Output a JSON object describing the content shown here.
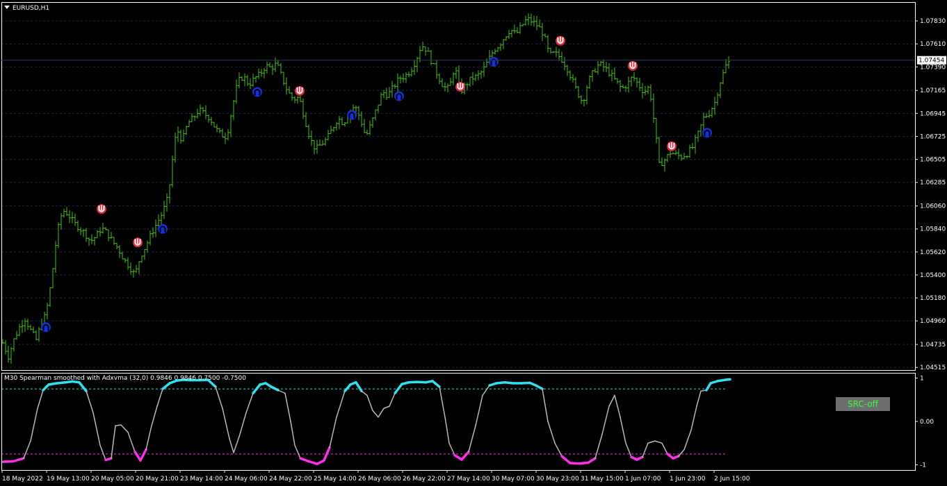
{
  "symbol_label": "EURUSD,H1",
  "indicator_title": "M30 Spearman smoothed with Adxvma (32,0) 0.9846 0.9846 0.7500 -0.7500",
  "button_label": "SRC-off",
  "current_price": "1.07454",
  "colors": {
    "background": "#000000",
    "bar": "#4cc11e",
    "axis": "#ffffff",
    "grid": "#1c2a52",
    "arrow_up": "#1531d8",
    "arrow_down": "#e2283c",
    "osc_line": "#b9b9b9",
    "osc_high": "#2ee0f0",
    "osc_low": "#ff2ee8",
    "level_high": "#2ee0f0",
    "level_low": "#ff2ee8"
  },
  "chart_data": [
    {
      "type": "ohlc",
      "name": "EURUSD,H1",
      "y_ticks": [
        "1.07830",
        "1.07610",
        "1.07390",
        "1.07165",
        "1.06945",
        "1.06725",
        "1.06505",
        "1.06285",
        "1.06060",
        "1.05840",
        "1.05620",
        "1.05400",
        "1.05180",
        "1.04960",
        "1.04735",
        "1.04515"
      ],
      "ylim": [
        1.0449,
        1.0801
      ],
      "current_price": 1.07454,
      "x_labels": [
        "18 May 2022",
        "19 May 13:00",
        "20 May 05:00",
        "20 May 21:00",
        "23 May 14:00",
        "24 May 06:00",
        "24 May 22:00",
        "25 May 14:00",
        "26 May 06:00",
        "26 May 22:00",
        "27 May 14:00",
        "30 May 07:00",
        "30 May 23:00",
        "31 May 15:00",
        "1 Jun 07:00",
        "1 Jun 23:00",
        "2 Jun 15:00"
      ],
      "close_path": [
        [
          0,
          1.0475
        ],
        [
          8,
          1.0462
        ],
        [
          16,
          1.0478
        ],
        [
          24,
          1.049
        ],
        [
          32,
          1.0498
        ],
        [
          40,
          1.0487
        ],
        [
          48,
          1.0478
        ],
        [
          56,
          1.0495
        ],
        [
          62,
          1.0502
        ],
        [
          70,
          1.0535
        ],
        [
          78,
          1.058
        ],
        [
          86,
          1.0602
        ],
        [
          94,
          1.0598
        ],
        [
          102,
          1.059
        ],
        [
          110,
          1.0585
        ],
        [
          118,
          1.058
        ],
        [
          126,
          1.0572
        ],
        [
          134,
          1.0577
        ],
        [
          142,
          1.0585
        ],
        [
          150,
          1.058
        ],
        [
          158,
          1.0572
        ],
        [
          166,
          1.0565
        ],
        [
          174,
          1.0555
        ],
        [
          182,
          1.0548
        ],
        [
          190,
          1.054
        ],
        [
          198,
          1.0558
        ],
        [
          206,
          1.0568
        ],
        [
          214,
          1.058
        ],
        [
          222,
          1.059
        ],
        [
          230,
          1.06
        ],
        [
          238,
          1.0615
        ],
        [
          244,
          1.065
        ],
        [
          250,
          1.068
        ],
        [
          258,
          1.0668
        ],
        [
          266,
          1.0685
        ],
        [
          274,
          1.069
        ],
        [
          282,
          1.0698
        ],
        [
          290,
          1.0694
        ],
        [
          298,
          1.069
        ],
        [
          306,
          1.068
        ],
        [
          314,
          1.0674
        ],
        [
          322,
          1.0672
        ],
        [
          330,
          1.07
        ],
        [
          338,
          1.0725
        ],
        [
          346,
          1.073
        ],
        [
          354,
          1.0722
        ],
        [
          362,
          1.0728
        ],
        [
          370,
          1.0732
        ],
        [
          378,
          1.074
        ],
        [
          386,
          1.0738
        ],
        [
          394,
          1.0742
        ],
        [
          402,
          1.0728
        ],
        [
          410,
          1.0715
        ],
        [
          418,
          1.0708
        ],
        [
          426,
          1.071
        ],
        [
          434,
          1.069
        ],
        [
          442,
          1.067
        ],
        [
          450,
          1.066
        ],
        [
          458,
          1.0665
        ],
        [
          466,
          1.067
        ],
        [
          474,
          1.068
        ],
        [
          482,
          1.069
        ],
        [
          490,
          1.0685
        ],
        [
          498,
          1.0695
        ],
        [
          506,
          1.0702
        ],
        [
          514,
          1.069
        ],
        [
          522,
          1.0672
        ],
        [
          530,
          1.0685
        ],
        [
          538,
          1.07
        ],
        [
          546,
          1.0715
        ],
        [
          554,
          1.0712
        ],
        [
          562,
          1.072
        ],
        [
          570,
          1.0728
        ],
        [
          578,
          1.073
        ],
        [
          586,
          1.0735
        ],
        [
          594,
          1.0745
        ],
        [
          602,
          1.076
        ],
        [
          610,
          1.0755
        ],
        [
          618,
          1.0742
        ],
        [
          626,
          1.073
        ],
        [
          634,
          1.072
        ],
        [
          642,
          1.0718
        ],
        [
          650,
          1.074
        ],
        [
          658,
          1.0715
        ],
        [
          666,
          1.0722
        ],
        [
          674,
          1.0728
        ],
        [
          682,
          1.073
        ],
        [
          690,
          1.0735
        ],
        [
          698,
          1.0745
        ],
        [
          706,
          1.0755
        ],
        [
          714,
          1.076
        ],
        [
          722,
          1.0768
        ],
        [
          730,
          1.0775
        ],
        [
          738,
          1.077
        ],
        [
          746,
          1.0778
        ],
        [
          754,
          1.0785
        ],
        [
          762,
          1.0782
        ],
        [
          770,
          1.0778
        ],
        [
          778,
          1.077
        ],
        [
          786,
          1.075
        ],
        [
          794,
          1.0752
        ],
        [
          802,
          1.0748
        ],
        [
          810,
          1.074
        ],
        [
          818,
          1.0728
        ],
        [
          826,
          1.0715
        ],
        [
          834,
          1.0705
        ],
        [
          842,
          1.0725
        ],
        [
          850,
          1.0735
        ],
        [
          858,
          1.0742
        ],
        [
          866,
          1.0738
        ],
        [
          874,
          1.0732
        ],
        [
          882,
          1.0725
        ],
        [
          890,
          1.0718
        ],
        [
          898,
          1.0722
        ],
        [
          906,
          1.073
        ],
        [
          914,
          1.0722
        ],
        [
          922,
          1.0715
        ],
        [
          930,
          1.072
        ],
        [
          938,
          1.068
        ],
        [
          944,
          1.0645
        ],
        [
          952,
          1.065
        ],
        [
          960,
          1.0657
        ],
        [
          968,
          1.0655
        ],
        [
          976,
          1.0653
        ],
        [
          984,
          1.0656
        ],
        [
          992,
          1.0662
        ],
        [
          1000,
          1.0675
        ],
        [
          1008,
          1.069
        ],
        [
          1016,
          1.0695
        ],
        [
          1024,
          1.0705
        ],
        [
          1032,
          1.0725
        ],
        [
          1040,
          1.074
        ],
        [
          1046,
          1.0745
        ]
      ],
      "signals": [
        {
          "x": 62,
          "price": 1.049,
          "dir": "up"
        },
        {
          "x": 142,
          "price": 1.0603,
          "dir": "down"
        },
        {
          "x": 194,
          "price": 1.0571,
          "dir": "down"
        },
        {
          "x": 230,
          "price": 1.0584,
          "dir": "up"
        },
        {
          "x": 366,
          "price": 1.0715,
          "dir": "up"
        },
        {
          "x": 427,
          "price": 1.0716,
          "dir": "down"
        },
        {
          "x": 502,
          "price": 1.0693,
          "dir": "up"
        },
        {
          "x": 570,
          "price": 1.0711,
          "dir": "up"
        },
        {
          "x": 658,
          "price": 1.072,
          "dir": "down"
        },
        {
          "x": 706,
          "price": 1.0744,
          "dir": "up"
        },
        {
          "x": 802,
          "price": 1.0764,
          "dir": "down"
        },
        {
          "x": 906,
          "price": 1.074,
          "dir": "down"
        },
        {
          "x": 962,
          "price": 1.0663,
          "dir": "down"
        },
        {
          "x": 1013,
          "price": 1.0676,
          "dir": "up"
        }
      ]
    },
    {
      "type": "line",
      "name": "M30 Spearman smoothed with Adxvma (32,0)",
      "y_ticks": [
        "1",
        "0.00",
        "-1"
      ],
      "ylim": [
        -1.12,
        1.12
      ],
      "levels": [
        0.75,
        -0.75
      ],
      "values_x_y": [
        [
          0,
          -0.93
        ],
        [
          15,
          -0.92
        ],
        [
          30,
          -0.85
        ],
        [
          40,
          -0.45
        ],
        [
          50,
          0.3
        ],
        [
          58,
          0.72
        ],
        [
          66,
          0.85
        ],
        [
          78,
          0.88
        ],
        [
          90,
          0.9
        ],
        [
          100,
          0.92
        ],
        [
          110,
          0.9
        ],
        [
          120,
          0.7
        ],
        [
          130,
          0.2
        ],
        [
          140,
          -0.55
        ],
        [
          148,
          -0.89
        ],
        [
          156,
          -0.85
        ],
        [
          162,
          -0.1
        ],
        [
          170,
          -0.08
        ],
        [
          180,
          -0.25
        ],
        [
          190,
          -0.7
        ],
        [
          198,
          -0.9
        ],
        [
          206,
          -0.65
        ],
        [
          214,
          -0.1
        ],
        [
          222,
          0.35
        ],
        [
          230,
          0.75
        ],
        [
          240,
          0.88
        ],
        [
          250,
          0.94
        ],
        [
          260,
          0.96
        ],
        [
          270,
          0.95
        ],
        [
          282,
          0.95
        ],
        [
          295,
          0.96
        ],
        [
          306,
          0.8
        ],
        [
          316,
          0.3
        ],
        [
          326,
          -0.4
        ],
        [
          332,
          -0.72
        ],
        [
          340,
          -0.35
        ],
        [
          350,
          0.2
        ],
        [
          360,
          0.65
        ],
        [
          370,
          0.85
        ],
        [
          378,
          0.88
        ],
        [
          386,
          0.8
        ],
        [
          396,
          0.72
        ],
        [
          406,
          0.65
        ],
        [
          414,
          0.0
        ],
        [
          420,
          -0.55
        ],
        [
          428,
          -0.85
        ],
        [
          440,
          -0.92
        ],
        [
          452,
          -0.98
        ],
        [
          462,
          -0.9
        ],
        [
          470,
          -0.6
        ],
        [
          480,
          0.1
        ],
        [
          492,
          0.7
        ],
        [
          500,
          0.85
        ],
        [
          508,
          0.9
        ],
        [
          516,
          0.7
        ],
        [
          524,
          0.6
        ],
        [
          532,
          0.25
        ],
        [
          540,
          0.1
        ],
        [
          548,
          0.3
        ],
        [
          556,
          0.35
        ],
        [
          564,
          0.65
        ],
        [
          574,
          0.86
        ],
        [
          584,
          0.9
        ],
        [
          596,
          0.91
        ],
        [
          608,
          0.9
        ],
        [
          618,
          0.93
        ],
        [
          628,
          0.8
        ],
        [
          636,
          0.1
        ],
        [
          642,
          -0.5
        ],
        [
          650,
          -0.78
        ],
        [
          660,
          -0.88
        ],
        [
          670,
          -0.7
        ],
        [
          680,
          -0.1
        ],
        [
          690,
          0.6
        ],
        [
          700,
          0.83
        ],
        [
          710,
          0.88
        ],
        [
          722,
          0.9
        ],
        [
          734,
          0.88
        ],
        [
          746,
          0.88
        ],
        [
          758,
          0.89
        ],
        [
          768,
          0.82
        ],
        [
          776,
          0.75
        ],
        [
          784,
          0.0
        ],
        [
          794,
          -0.5
        ],
        [
          804,
          -0.8
        ],
        [
          816,
          -0.96
        ],
        [
          830,
          -0.97
        ],
        [
          842,
          -0.95
        ],
        [
          852,
          -0.85
        ],
        [
          862,
          -0.3
        ],
        [
          872,
          0.35
        ],
        [
          880,
          0.6
        ],
        [
          888,
          0.1
        ],
        [
          896,
          -0.5
        ],
        [
          904,
          -0.82
        ],
        [
          912,
          -0.88
        ],
        [
          920,
          -0.82
        ],
        [
          928,
          -0.5
        ],
        [
          938,
          -0.45
        ],
        [
          948,
          -0.5
        ],
        [
          956,
          -0.75
        ],
        [
          964,
          -0.85
        ],
        [
          972,
          -0.8
        ],
        [
          980,
          -0.65
        ],
        [
          990,
          -0.2
        ],
        [
          998,
          0.35
        ],
        [
          1004,
          0.7
        ],
        [
          1012,
          0.72
        ],
        [
          1018,
          0.88
        ],
        [
          1028,
          0.93
        ],
        [
          1040,
          0.96
        ],
        [
          1046,
          0.97
        ]
      ]
    }
  ]
}
